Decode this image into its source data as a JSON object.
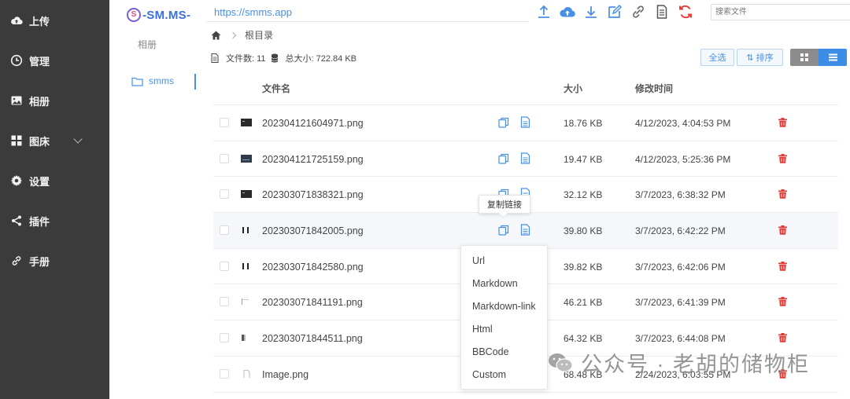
{
  "sidebar": {
    "items": [
      {
        "label": "上传",
        "icon": "cloud-upload-icon"
      },
      {
        "label": "管理",
        "icon": "clock-icon"
      },
      {
        "label": "相册",
        "icon": "image-icon"
      },
      {
        "label": "图床",
        "icon": "grid-icon"
      },
      {
        "label": "设置",
        "icon": "gear-icon"
      },
      {
        "label": "插件",
        "icon": "share-icon"
      },
      {
        "label": "手册",
        "icon": "link-icon"
      }
    ]
  },
  "album": {
    "logo_letter": "S",
    "logo_text": "-SM.MS-",
    "title": "相册",
    "items": [
      {
        "label": "smms",
        "icon": "folder-icon"
      }
    ]
  },
  "header": {
    "url": "https://smms.app",
    "search_placeholder": "搜索文件",
    "toolbar": [
      "upload-arrow-icon",
      "cloud-upload-icon",
      "download-icon",
      "edit-icon",
      "link-icon",
      "document-icon",
      "refresh-icon"
    ]
  },
  "breadcrumb": {
    "root": "根目录"
  },
  "stats": {
    "count_label": "文件数: 11",
    "size_label": "总大小: 722.84 KB"
  },
  "actions": {
    "select_all": "全选",
    "sort": "⇅ 排序"
  },
  "table": {
    "headers": {
      "name": "文件名",
      "size": "大小",
      "mtime": "修改时间"
    },
    "rows": [
      {
        "name": "202304121604971.png",
        "size": "18.76 KB",
        "mtime": "4/12/2023, 4:04:53 PM"
      },
      {
        "name": "202304121725159.png",
        "size": "19.47 KB",
        "mtime": "4/12/2023, 5:25:36 PM"
      },
      {
        "name": "202303071838321.png",
        "size": "32.12 KB",
        "mtime": "3/7/2023, 6:38:32 PM"
      },
      {
        "name": "202303071842005.png",
        "size": "39.80 KB",
        "mtime": "3/7/2023, 6:42:22 PM"
      },
      {
        "name": "202303071842580.png",
        "size": "39.82 KB",
        "mtime": "3/7/2023, 6:42:06 PM"
      },
      {
        "name": "202303071841191.png",
        "size": "46.21 KB",
        "mtime": "3/7/2023, 6:41:39 PM"
      },
      {
        "name": "202303071844511.png",
        "size": "64.32 KB",
        "mtime": "3/7/2023, 6:44:08 PM"
      },
      {
        "name": "Image.png",
        "size": "68.48 KB",
        "mtime": "2/24/2023, 6:03:55 PM"
      }
    ]
  },
  "tooltip": {
    "text": "复制链接"
  },
  "copy_menu": {
    "options": [
      "Url",
      "Markdown",
      "Markdown-link",
      "Html",
      "BBCode",
      "Custom"
    ]
  },
  "watermark": {
    "text": "公众号 · 老胡的储物柜"
  },
  "colors": {
    "sidebar_bg": "#3b3b3b",
    "accent": "#4a90e2",
    "delete": "#e53935",
    "refresh": "#e53935"
  }
}
